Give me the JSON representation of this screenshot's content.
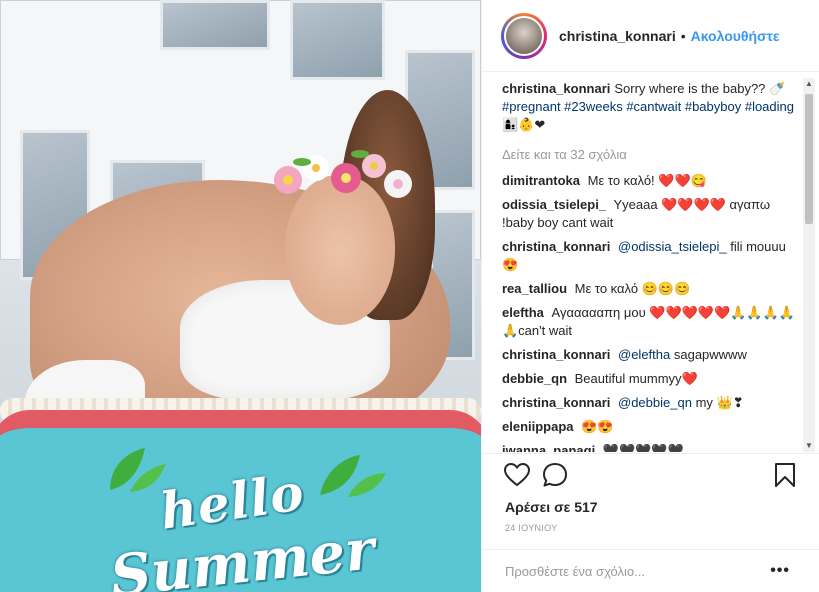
{
  "header": {
    "username": "christina_konnari",
    "separator": "•",
    "follow_label": "Ακολουθήστε"
  },
  "caption": {
    "username": "christina_konnari",
    "text": "Sorry where is the baby??",
    "emoji_bottle": "🍼",
    "hashtags": "#pregnant #23weeks #cantwait #babyboy #loading",
    "emojis": "👩‍👦👶❤"
  },
  "view_more": "Δείτε και τα 32 σχόλια",
  "comments": [
    {
      "username": "dimitrantoka",
      "text": "Με το καλό! ❤️❤️😋"
    },
    {
      "username": "odissia_tsielepi_",
      "text": "Yyeaaa ❤️❤️❤️❤️ αγαπω !baby boy cant wait"
    },
    {
      "username": "christina_konnari",
      "mention": "@odissia_tsielepi_",
      "text": "fili mouuu😍"
    },
    {
      "username": "rea_talliou",
      "text": "Με το καλό 😊😊😊"
    },
    {
      "username": "eleftha",
      "text": "Αγαααααπη μου ❤️❤️❤️❤️❤️🙏🙏🙏🙏🙏can't wait"
    },
    {
      "username": "christina_konnari",
      "mention": "@eleftha",
      "text": "sagapwwww"
    },
    {
      "username": "debbie_qn",
      "text": "Beautiful mummyy❤️"
    },
    {
      "username": "christina_konnari",
      "mention": "@debbie_qn",
      "text": "my 👑❣"
    },
    {
      "username": "eleniippapa",
      "text": "😍😍"
    },
    {
      "username": "iwanna_panagi",
      "text": "🖤🖤🖤🖤🖤"
    }
  ],
  "likes_label": "Αρέσει σε 517",
  "date_label": "24 ΙΟΥΝΙΟΥ",
  "add_comment_placeholder": "Προσθέστε ένα σχόλιο...",
  "more_options": "•••",
  "photo": {
    "text_hello": "hello",
    "text_summer": "Summer"
  },
  "icons": {
    "like": "heart-outline-icon",
    "comment": "comment-bubble-icon",
    "save": "bookmark-icon"
  },
  "colors": {
    "follow": "#3897f0",
    "mention": "#003569",
    "muted": "#999999"
  }
}
